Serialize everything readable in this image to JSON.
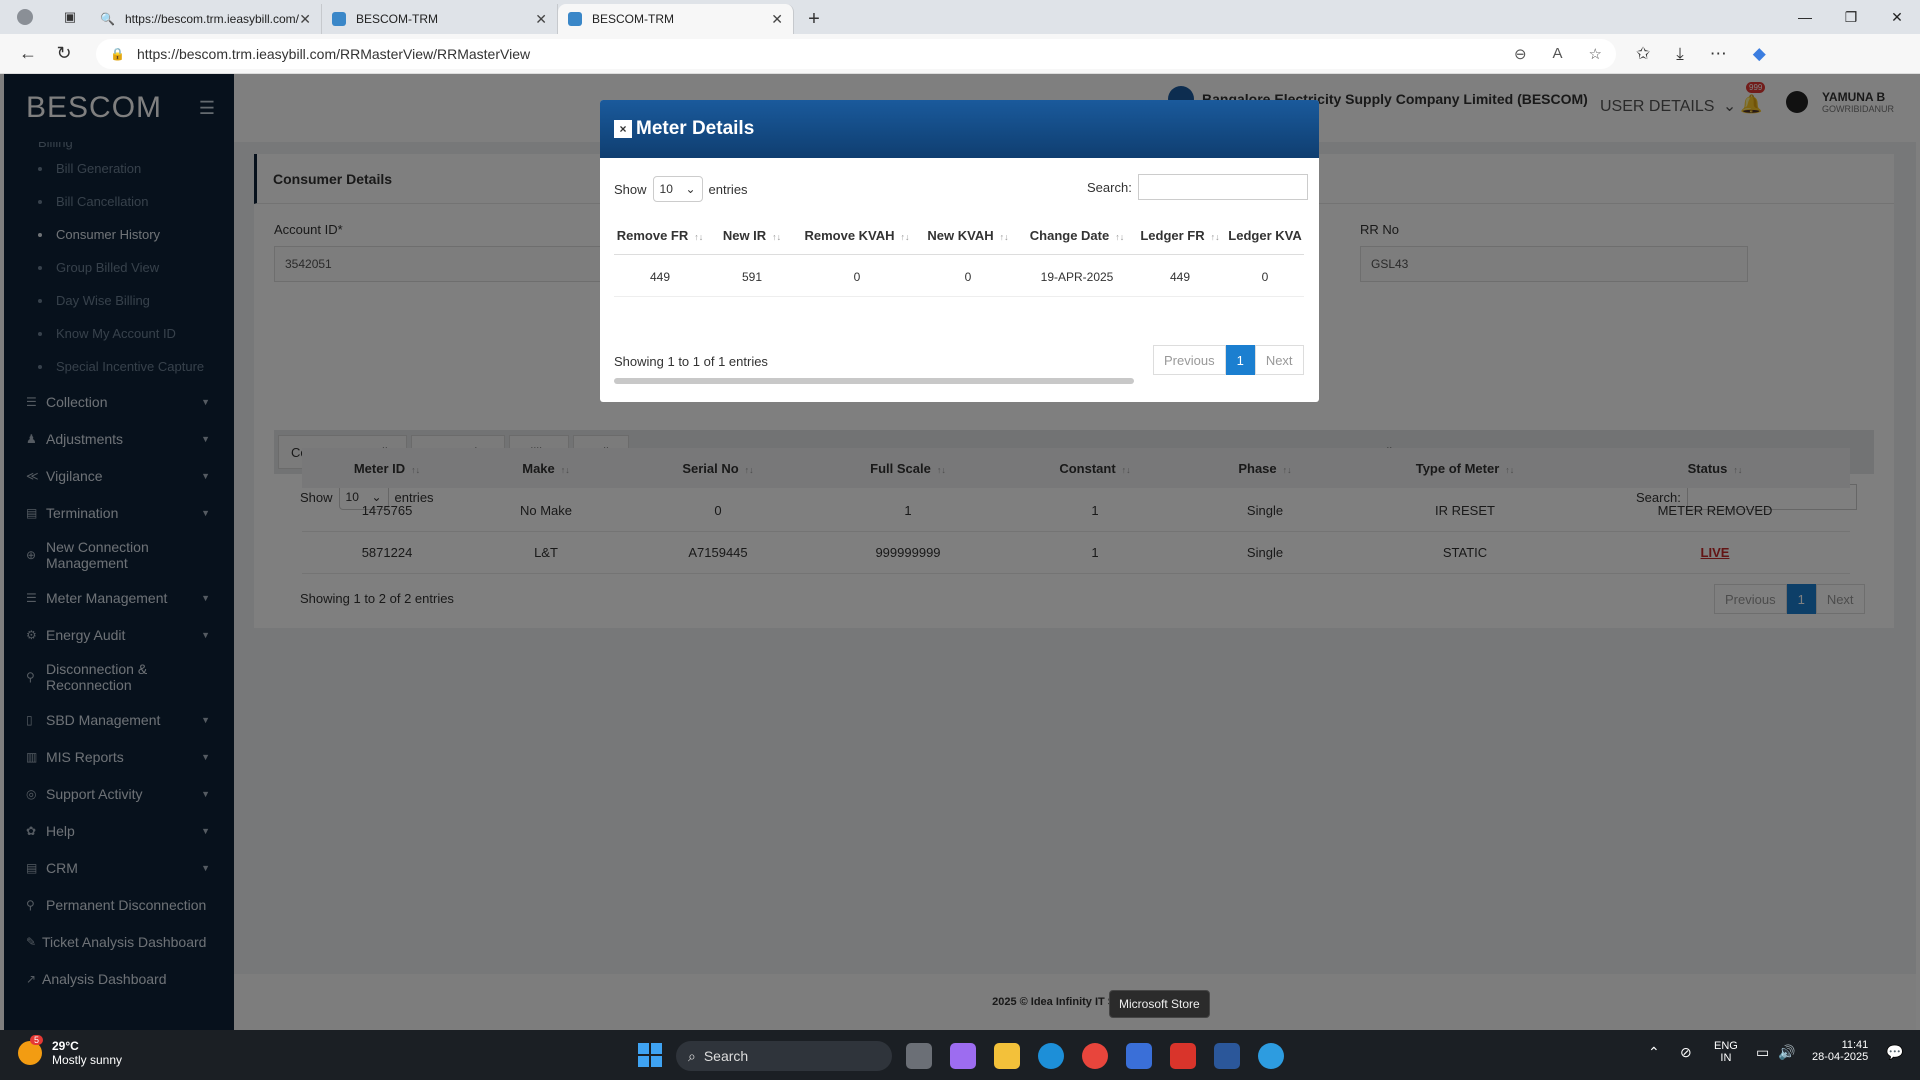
{
  "browser": {
    "tabs": [
      {
        "label": "https://bescom.trm.ieasybill.com/"
      },
      {
        "label": "BESCOM-TRM"
      },
      {
        "label": "BESCOM-TRM"
      }
    ],
    "url": "https://bescom.trm.ieasybill.com/RRMasterView/RRMasterView"
  },
  "sidebar": {
    "brand": "BESCOM",
    "partial_item": "Billing",
    "sub_items": [
      {
        "label": "Bill Generation"
      },
      {
        "label": "Bill Cancellation"
      },
      {
        "label": "Consumer History",
        "active": true
      },
      {
        "label": "Group Billed View"
      },
      {
        "label": "Day Wise Billing"
      },
      {
        "label": "Know My Account ID"
      },
      {
        "label": "Special Incentive Capture"
      }
    ],
    "menu": [
      {
        "label": "Collection"
      },
      {
        "label": "Adjustments"
      },
      {
        "label": "Vigilance"
      },
      {
        "label": "Termination"
      },
      {
        "label": "New Connection Management"
      },
      {
        "label": "Meter Management"
      },
      {
        "label": "Energy Audit"
      },
      {
        "label": "Disconnection & Reconnection"
      },
      {
        "label": "SBD Management"
      },
      {
        "label": "MIS Reports"
      },
      {
        "label": "Support Activity"
      },
      {
        "label": "Help"
      },
      {
        "label": "CRM"
      },
      {
        "label": "Permanent Disconnection"
      },
      {
        "label": "Ticket Analysis Dashboard"
      },
      {
        "label": "Analysis Dashboard"
      }
    ]
  },
  "header": {
    "company": "Bangalore Electricity Supply Company Limited (BESCOM)",
    "user_details": "USER DETAILS",
    "notification_count": "999",
    "user_name": "YAMUNA B",
    "user_location": "GOWRIBIDANUR"
  },
  "consumer": {
    "title": "Consumer Details",
    "account_label": "Account ID*",
    "account_value": "3542051",
    "rr_label": "RR No",
    "rr_value": "GSL43",
    "tabs": [
      "Consumer Details",
      "Transaction",
      "Billing",
      "Colle",
      "TPV Details"
    ],
    "show": "Show",
    "entries_value": "10",
    "entries": "entries",
    "search_label": "Search:",
    "columns": [
      "Meter ID",
      "Make",
      "Serial No",
      "Full Scale",
      "Constant",
      "Phase",
      "Type of Meter",
      "Status"
    ],
    "rows": [
      [
        "1475765",
        "No Make",
        "0",
        "1",
        "1",
        "Single",
        "IR RESET",
        "METER REMOVED"
      ],
      [
        "5871224",
        "L&T",
        "A7159445",
        "999999999",
        "1",
        "Single",
        "STATIC",
        "LIVE"
      ]
    ],
    "showing": "Showing 1 to 2 of 2 entries",
    "prev": "Previous",
    "page": "1",
    "next": "Next"
  },
  "footer": "2025 © Idea Infinity IT Solutions",
  "modal": {
    "title": "Meter Details",
    "close": "×",
    "show": "Show",
    "entries_value": "10",
    "entries": "entries",
    "search_label": "Search:",
    "columns": [
      "Remove FR",
      "New IR",
      "Remove KVAH",
      "New KVAH",
      "Change Date",
      "Ledger FR",
      "Ledger KVA"
    ],
    "row": [
      "449",
      "591",
      "0",
      "0",
      "19-APR-2025",
      "449",
      "0"
    ],
    "showing": "Showing 1 to 1 of 1 entries",
    "prev": "Previous",
    "page": "1",
    "next": "Next"
  },
  "taskbar": {
    "weather_temp": "29°C",
    "weather_desc": "Mostly sunny",
    "weather_badge": "5",
    "search": "Search",
    "tooltip": "Microsoft Store",
    "lang1": "ENG",
    "lang2": "IN",
    "time": "11:41",
    "date": "28-04-2025"
  }
}
